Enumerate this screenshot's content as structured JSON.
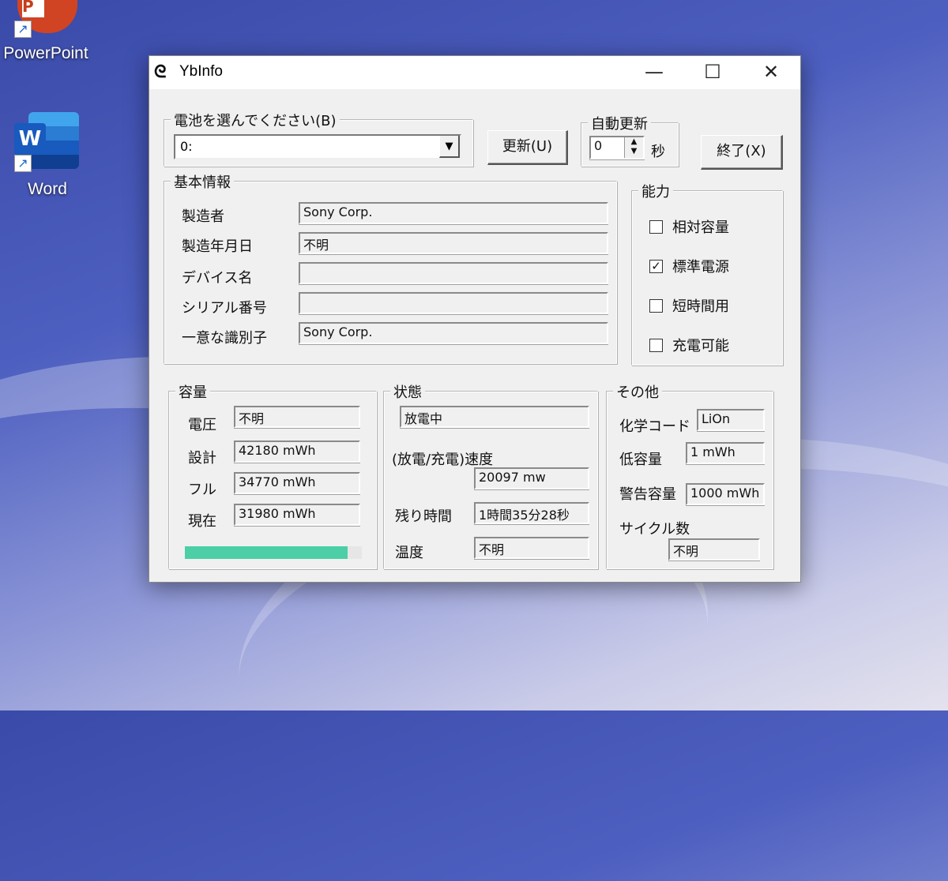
{
  "desktop": {
    "icons": [
      {
        "label": "PowerPoint",
        "glyph": "P"
      },
      {
        "label": "Word",
        "glyph": "W"
      }
    ]
  },
  "window": {
    "title": "YbInfo",
    "controls": {
      "minimize": "—",
      "maximize": "☐",
      "close": "✕"
    }
  },
  "battery_select": {
    "legend": "電池を選んでください(B)",
    "selected": "0:",
    "arrow": "▼"
  },
  "toolbar": {
    "refresh_label": "更新(U)",
    "auto_update_legend": "自動更新",
    "auto_update_value": "0",
    "auto_update_unit": "秒",
    "exit_label": "終了(X)"
  },
  "basic_info": {
    "legend": "基本情報",
    "rows": [
      {
        "label": "製造者",
        "value": "Sony Corp."
      },
      {
        "label": "製造年月日",
        "value": "不明"
      },
      {
        "label": "デバイス名",
        "value": ""
      },
      {
        "label": "シリアル番号",
        "value": ""
      },
      {
        "label": "一意な識別子",
        "value": "Sony Corp."
      }
    ]
  },
  "capability": {
    "legend": "能力",
    "items": [
      {
        "label": "相対容量",
        "checked": false
      },
      {
        "label": "標準電源",
        "checked": true
      },
      {
        "label": "短時間用",
        "checked": false
      },
      {
        "label": "充電可能",
        "checked": false
      }
    ],
    "check_glyph": "✓"
  },
  "capacity": {
    "legend": "容量",
    "rows": [
      {
        "label": "電圧",
        "value": "不明"
      },
      {
        "label": "設計",
        "value": "42180 mWh"
      },
      {
        "label": "フル",
        "value": "34770 mWh"
      },
      {
        "label": "現在",
        "value": "31980 mWh"
      }
    ],
    "charge_fraction": 0.92,
    "bar_color": "#4ccfa6"
  },
  "status": {
    "legend": "状態",
    "state": "放電中",
    "rate_label": "(放電/充電)速度",
    "rate_value": "20097 mw",
    "remaining_label": "残り時間",
    "remaining_value": "1時間35分28秒",
    "temp_label": "温度",
    "temp_value": "不明"
  },
  "other": {
    "legend": "その他",
    "chemistry_label": "化学コード",
    "chemistry_value": "LiOn",
    "low_label": "低容量",
    "low_value": "1 mWh",
    "warn_label": "警告容量",
    "warn_value": "1000 mWh",
    "cycle_label": "サイクル数",
    "cycle_value": "不明"
  }
}
